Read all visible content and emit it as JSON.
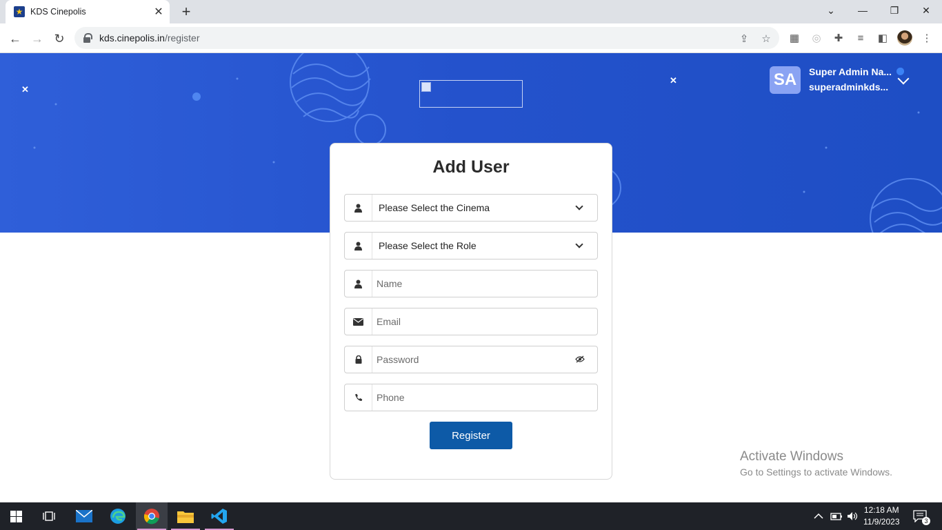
{
  "browser": {
    "tab_title": "KDS Cinepolis",
    "url_host": "kds.cinepolis.in",
    "url_path": "/register"
  },
  "header": {
    "avatar_initials": "SA",
    "user_name": "Super Admin Na...",
    "user_email": "superadminkds..."
  },
  "form": {
    "title": "Add User",
    "cinema_select": "Please Select the Cinema",
    "role_select": "Please Select the Role",
    "name_placeholder": "Name",
    "email_placeholder": "Email",
    "password_placeholder": "Password",
    "phone_placeholder": "Phone",
    "register_label": "Register"
  },
  "watermark": {
    "title": "Activate Windows",
    "subtitle": "Go to Settings to activate Windows."
  },
  "taskbar": {
    "time": "12:18 AM",
    "date": "11/9/2023",
    "notification_count": "3"
  },
  "icons": {
    "cinema": "user-icon",
    "role": "user-icon",
    "name": "user-icon",
    "email": "envelope-icon",
    "password": "lock-icon",
    "phone": "phone-icon"
  }
}
